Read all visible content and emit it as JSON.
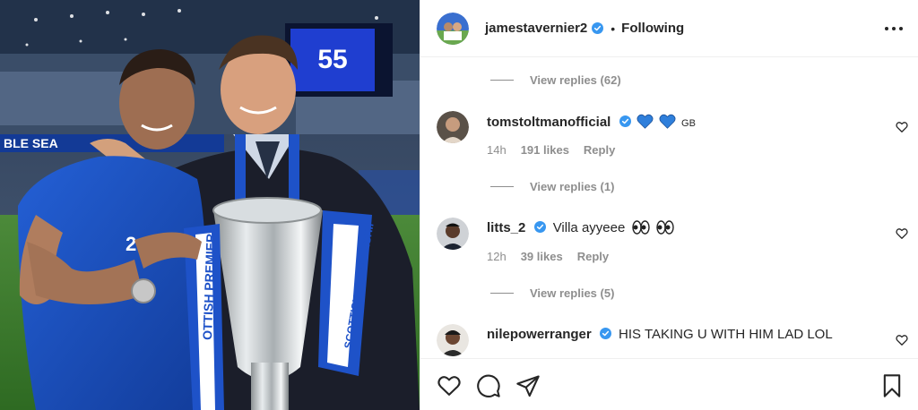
{
  "post": {
    "author": "jamestavernier2",
    "follow_separator": "•",
    "follow_status": "Following"
  },
  "comments": [
    {
      "type": "view_replies",
      "label": "View replies (62)"
    },
    {
      "type": "comment",
      "username": "tomstoltmanofficial",
      "verified": true,
      "body": "",
      "body_emoji": [
        "blue-heart",
        "blue-heart"
      ],
      "body_suffix": "GB",
      "time": "14h",
      "likes": "191 likes",
      "reply": "Reply"
    },
    {
      "type": "view_replies",
      "label": "View replies (1)"
    },
    {
      "type": "comment",
      "username": "litts_2",
      "verified": true,
      "body": "Villa ayyeee",
      "body_emoji": [
        "eyes",
        "eyes"
      ],
      "time": "12h",
      "likes": "39 likes",
      "reply": "Reply"
    },
    {
      "type": "view_replies",
      "label": "View replies (5)"
    },
    {
      "type": "comment",
      "username": "nilepowerranger",
      "verified": true,
      "body": "HIS TAKING U WITH HIM LAD LOL",
      "time": "",
      "likes": "",
      "reply": ""
    }
  ],
  "actions": {
    "like_icon": "heart-outline-icon",
    "comment_icon": "comment-bubble-icon",
    "share_icon": "paper-plane-icon",
    "save_icon": "bookmark-icon"
  },
  "photo": {
    "scoreboard_text": "55",
    "stand_text": "BLE SEA",
    "trophy_ribbon_text": "OTTISH PREMIER",
    "ribbon_text_2": "SCOTTISH PREMIERSHIP",
    "shirt_number": "2"
  },
  "colors": {
    "verified_blue": "#3897f0",
    "heart_blue": "#2f7fdb",
    "muted_text": "#8e8e8e",
    "text": "#262626",
    "rangers_blue": "#1b56c8"
  }
}
